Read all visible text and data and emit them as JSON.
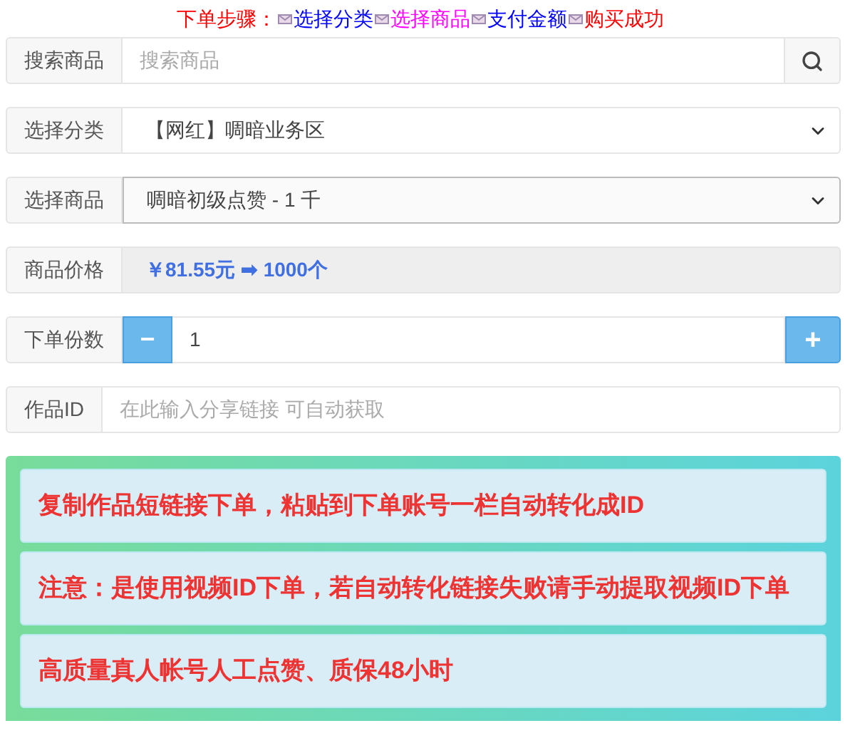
{
  "steps": {
    "label": "下单步骤：",
    "items": [
      {
        "text": "选择分类",
        "color": "#0000ff"
      },
      {
        "text": "选择商品",
        "color": "#ff00ff"
      },
      {
        "text": "支付金额",
        "color": "#0000ff"
      },
      {
        "text": "购买成功",
        "color": "#ff0000"
      }
    ]
  },
  "form": [
    {
      "kind": "search",
      "label": "搜索商品",
      "placeholder": "搜索商品"
    },
    {
      "kind": "select",
      "label": "选择分类",
      "value": "【网红】啁暗业务区"
    },
    {
      "kind": "select",
      "label": "选择商品",
      "value": "啁暗初级点赞 - 1 千"
    },
    {
      "kind": "price",
      "label": "商品价格",
      "value": "￥81.55元 ➡ 1000个"
    },
    {
      "kind": "quantity",
      "label": "下单份数",
      "value": "1",
      "minus": "−",
      "plus": "+"
    },
    {
      "kind": "text",
      "label": "作品ID",
      "placeholder": "在此输入分享链接 可自动获取"
    }
  ],
  "notices": [
    "复制作品短链接下单，粘贴到下单账号一栏自动转化成ID",
    "注意：是使用视频ID下单，若自动转化链接失败请手动提取视频ID下单",
    "高质量真人帐号人工点赞、质保48小时"
  ]
}
